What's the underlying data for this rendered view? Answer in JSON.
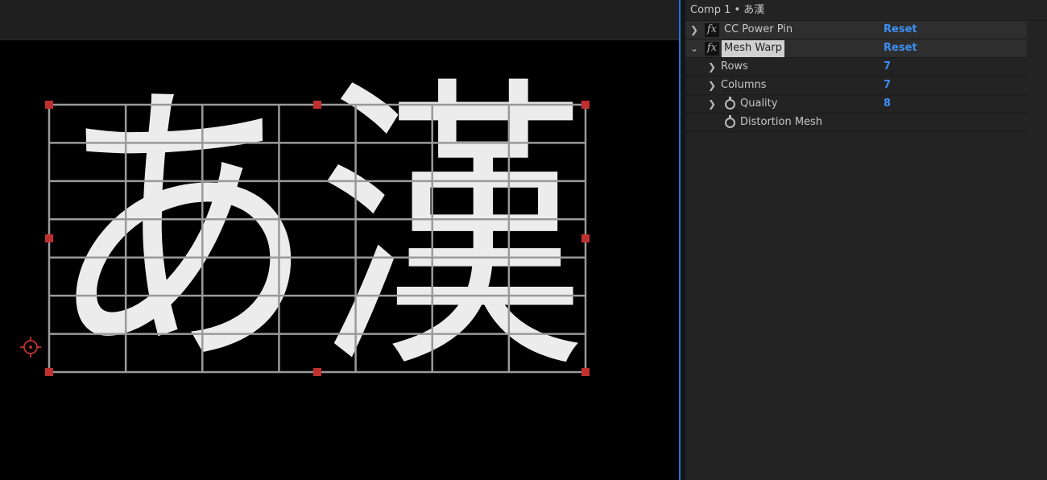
{
  "viewer": {
    "text": "あ漢",
    "mesh": {
      "rows": 7,
      "columns": 7
    },
    "colors": {
      "grid": "#9a9a9a",
      "handle": "#c0302e",
      "text": "#ececec"
    }
  },
  "effects_panel": {
    "title": "Comp 1 • あ漢",
    "effects": [
      {
        "name": "CC Power Pin",
        "reset": "Reset",
        "expanded": false
      },
      {
        "name": "Mesh Warp",
        "reset": "Reset",
        "expanded": true,
        "properties": [
          {
            "label": "Rows",
            "value": "7"
          },
          {
            "label": "Columns",
            "value": "7"
          },
          {
            "label": "Quality",
            "value": "8"
          },
          {
            "label": "Distortion Mesh"
          }
        ]
      }
    ],
    "accent": "#3d8ef2"
  }
}
